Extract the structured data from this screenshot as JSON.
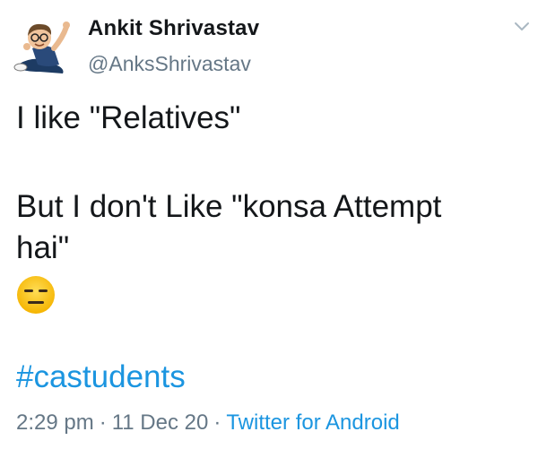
{
  "author": {
    "name": "Ankit Shrivastav",
    "handle": "@AnksShrivastav"
  },
  "tweet": {
    "line1": "I like \"Relatives\"",
    "line2": "But I don't Like \"konsa Attempt",
    "line3": "hai\"",
    "emoji": "expressionless-face",
    "hashtag": "#castudents"
  },
  "meta": {
    "time": "2:29 pm",
    "separator": "·",
    "date": "11 Dec 20",
    "source": "Twitter for Android"
  },
  "colors": {
    "link": "#1b95e0",
    "secondary_text": "#657786",
    "primary_text": "#14171a"
  }
}
